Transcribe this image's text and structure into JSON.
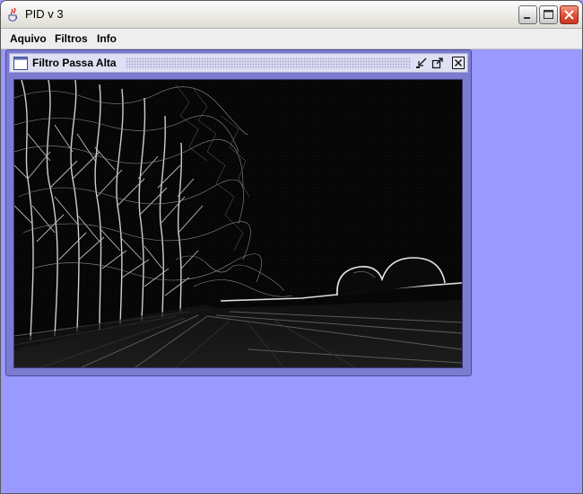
{
  "window": {
    "title": "PID v 3",
    "icon": "java-cup-icon",
    "controls": {
      "minimize": "minimize-icon",
      "maximize": "maximize-icon",
      "close": "close-icon"
    }
  },
  "menu": [
    {
      "label": "Aquivo"
    },
    {
      "label": "Filtros"
    },
    {
      "label": "Info"
    }
  ],
  "internal_frame": {
    "title": "Filtro Passa Alta",
    "icon": "window-icon",
    "controls": {
      "iconify": "iconify-icon",
      "maximize": "maximize-icon",
      "close": "close-icon"
    }
  },
  "image": {
    "description_icon": "edge-filtered-photo",
    "subject": "high-pass filtered photo"
  },
  "colors": {
    "desktop": "#9999ff",
    "frame_border": "#7b7bcf",
    "frame_title": "#dfe0f3",
    "menubar": "#eeeeee",
    "close_button": "#e0503a"
  }
}
